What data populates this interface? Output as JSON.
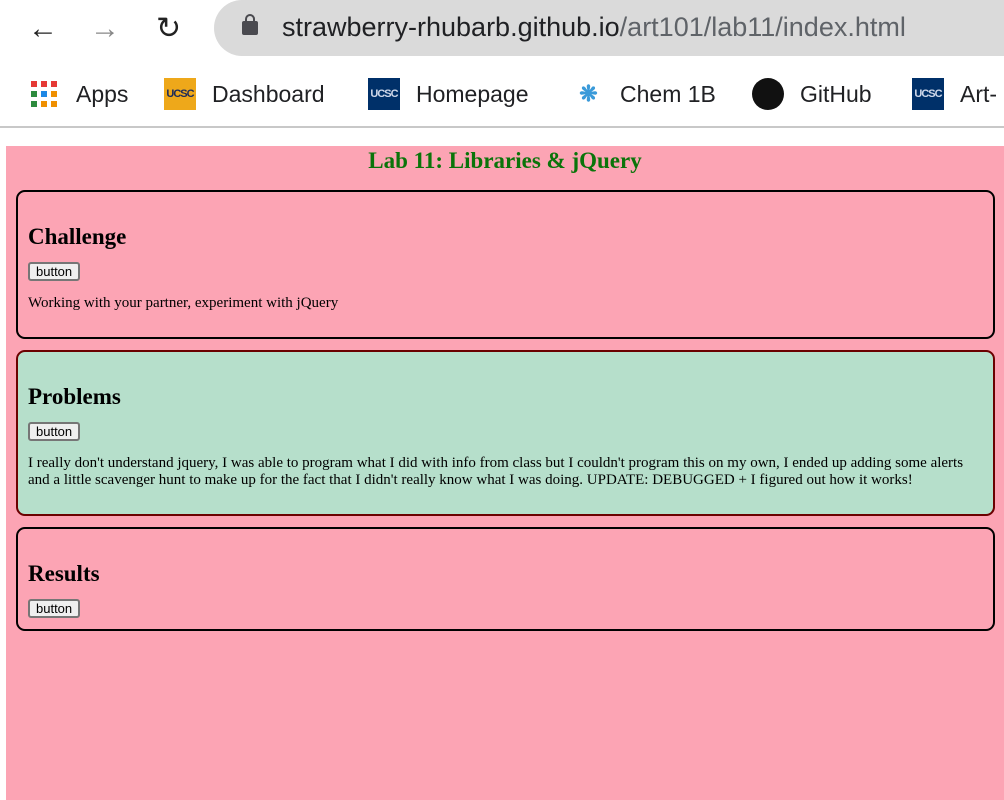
{
  "browser": {
    "url_host": "strawberry-rhubarb.github.io",
    "url_path": "/art101/lab11/index.html",
    "bookmarks": [
      {
        "label": "Apps",
        "icon": "apps-grid-icon"
      },
      {
        "label": "Dashboard",
        "icon": "ucsc-gold-icon",
        "logo_text": "UCSC"
      },
      {
        "label": "Homepage",
        "icon": "ucsc-blue-icon",
        "logo_text": "UCSC"
      },
      {
        "label": "Chem 1B",
        "icon": "chem-icon"
      },
      {
        "label": "GitHub",
        "icon": "github-icon"
      },
      {
        "label": "Art-",
        "icon": "ucsc-blue-icon",
        "logo_text": "UCSC"
      }
    ]
  },
  "page": {
    "title": "Lab 11: Libraries & jQuery",
    "sections": [
      {
        "heading": "Challenge",
        "button": "button",
        "text": "Working with your partner, experiment with jQuery"
      },
      {
        "heading": "Problems",
        "button": "button",
        "text": "I really don't understand jquery, I was able to program what I did with info from class but I couldn't program this on my own, I ended up adding some alerts and a little scavenger hunt to make up for the fact that I didn't really know what I was doing. UPDATE: DEBUGGED + I figured out how it works!"
      },
      {
        "heading": "Results",
        "button": "button"
      }
    ]
  },
  "colors": {
    "page_bg": "#fca4b4",
    "title": "#0a740a",
    "problems_bg": "#b6dfcb"
  }
}
